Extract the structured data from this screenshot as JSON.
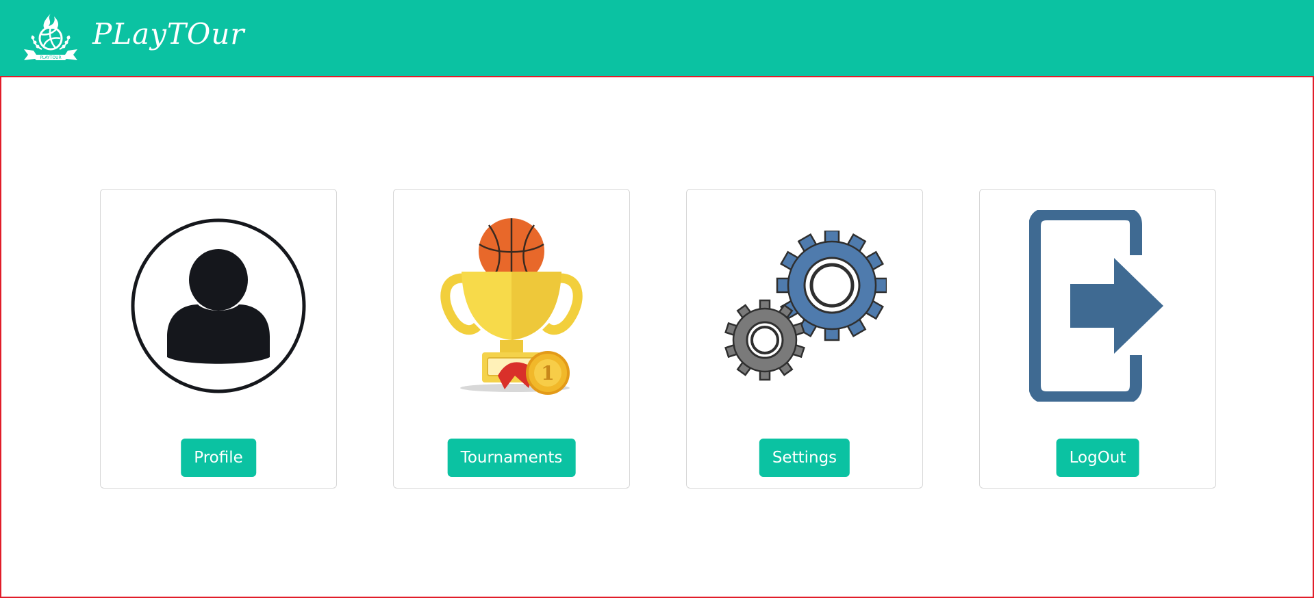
{
  "brand": {
    "name": "PLayTOur",
    "logo_icon": "volleyball-flame-logo-icon",
    "logo_caption": "PLAYTOUR"
  },
  "colors": {
    "primary": "#0bc2a2",
    "content_border": "#e11d2a",
    "card_border": "#d6d6d6"
  },
  "cards": [
    {
      "icon": "user-avatar-icon",
      "label": "Profile"
    },
    {
      "icon": "trophy-basketball-icon",
      "label": "Tournaments"
    },
    {
      "icon": "gears-icon",
      "label": "Settings"
    },
    {
      "icon": "logout-door-arrow-icon",
      "label": "LogOut"
    }
  ]
}
